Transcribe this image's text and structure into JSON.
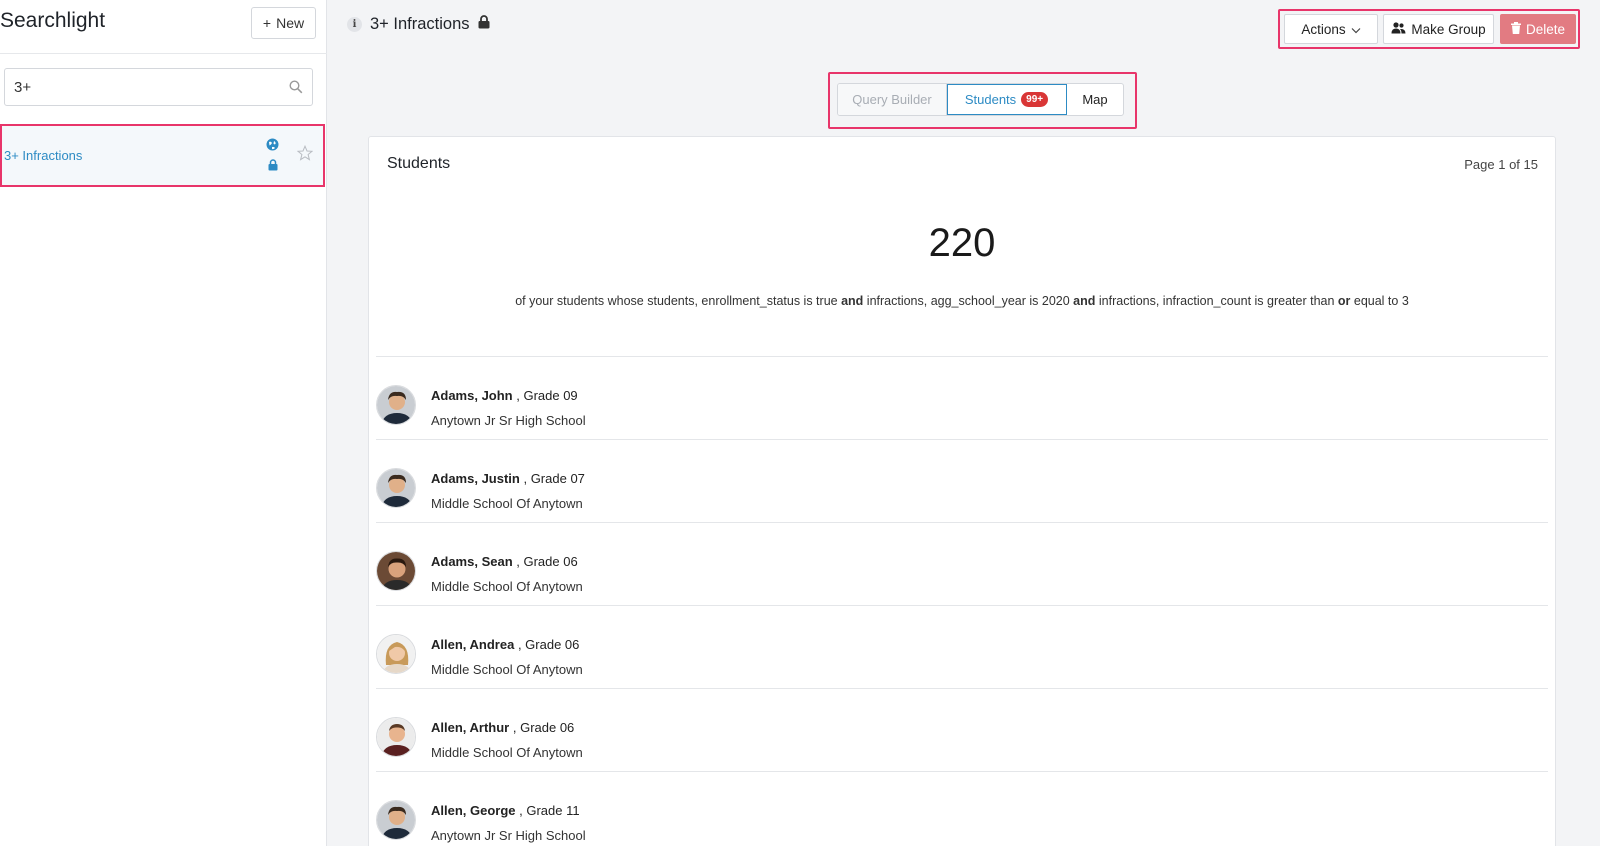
{
  "sidebar": {
    "app_title": "Searchlight",
    "new_button": "New",
    "search": {
      "value": "3+",
      "placeholder": ""
    },
    "saved_searches": [
      {
        "label": "3+ Infractions",
        "icons": [
          "globe-icon",
          "lock-icon",
          "star-icon"
        ]
      }
    ]
  },
  "header": {
    "title": "3+ Infractions",
    "actions_label": "Actions",
    "make_group_label": "Make Group",
    "delete_label": "Delete"
  },
  "tabs": {
    "query_builder": "Query Builder",
    "students": "Students",
    "students_badge": "99+",
    "map": "Map"
  },
  "results": {
    "title": "Students",
    "page_info": "Page 1 of 15",
    "count": "220",
    "description": {
      "part1": "of your students whose students, enrollment_status is true ",
      "and1": "and",
      "part2": " infractions, agg_school_year is 2020 ",
      "and2": "and",
      "part3": " infractions, infraction_count is greater than ",
      "or": "or",
      "part4": " equal to 3"
    },
    "students": [
      {
        "name": "Adams, John",
        "grade": " , Grade 09",
        "school": "Anytown Jr Sr High School"
      },
      {
        "name": "Adams, Justin",
        "grade": " , Grade 07",
        "school": "Middle School Of Anytown"
      },
      {
        "name": "Adams, Sean",
        "grade": " , Grade 06",
        "school": "Middle School Of Anytown"
      },
      {
        "name": "Allen, Andrea",
        "grade": " , Grade 06",
        "school": "Middle School Of Anytown"
      },
      {
        "name": "Allen, Arthur",
        "grade": " , Grade 06",
        "school": "Middle School Of Anytown"
      },
      {
        "name": "Allen, George",
        "grade": " , Grade 11",
        "school": "Anytown Jr Sr High School"
      }
    ]
  },
  "colors": {
    "accent": "#2d8bc4",
    "highlight": "#e8356a",
    "delete": "#e27b82",
    "badge": "#d93636"
  }
}
